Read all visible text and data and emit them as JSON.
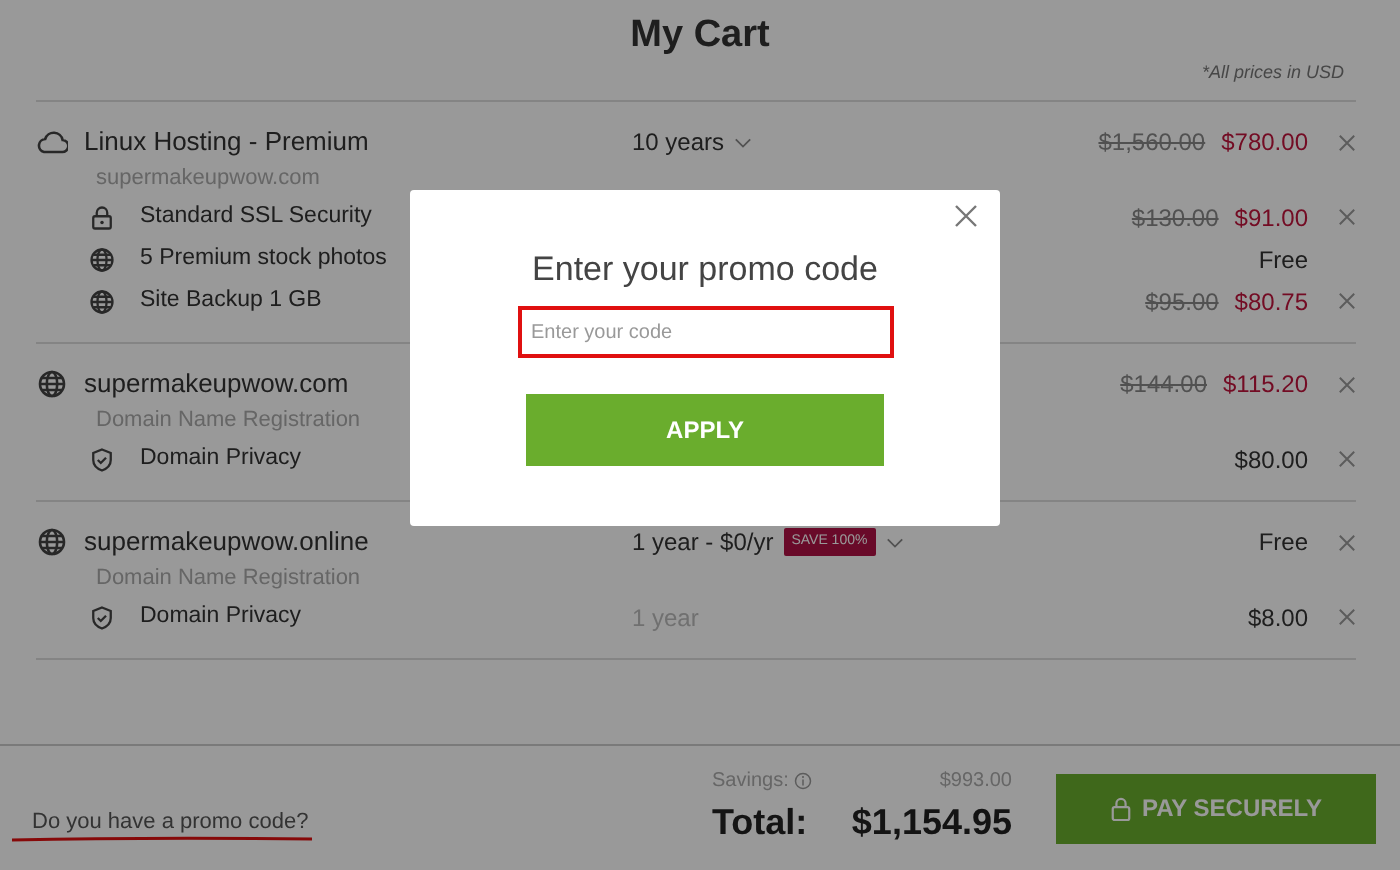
{
  "page": {
    "title": "My Cart",
    "price_note": "*All prices in USD"
  },
  "groups": [
    {
      "kind": "cloud",
      "name": "Linux Hosting - Premium",
      "subtitle": "supermakeupwow.com",
      "term": "10 years",
      "old_price": "$1,560.00",
      "price": "$780.00",
      "discounted": true,
      "removable": true,
      "addons": [
        {
          "kind": "lock",
          "name": "Standard SSL Security",
          "old_price": "$130.00",
          "price": "$91.00",
          "discounted": true,
          "removable": true
        },
        {
          "kind": "globe",
          "name": "5 Premium stock photos",
          "price": "Free",
          "discounted": false,
          "removable": false
        },
        {
          "kind": "globe",
          "name": "Site Backup 1 GB",
          "old_price": "$95.00",
          "price": "$80.75",
          "discounted": true,
          "removable": true
        }
      ]
    },
    {
      "kind": "globe",
      "name": "supermakeupwow.com",
      "subtitle": "Domain Name Registration",
      "old_price": "$144.00",
      "price": "$115.20",
      "discounted": true,
      "removable": true,
      "addons": [
        {
          "kind": "shield",
          "name": "Domain Privacy",
          "price": "$80.00",
          "discounted": false,
          "removable": true
        }
      ]
    },
    {
      "kind": "globe",
      "name": "supermakeupwow.online",
      "subtitle": "Domain Name Registration",
      "term": "1 year - $0/yr",
      "badge": "SAVE 100%",
      "price": "Free",
      "discounted": false,
      "removable": true,
      "addons": [
        {
          "kind": "shield",
          "name": "Domain Privacy",
          "term": "1 year",
          "price": "$8.00",
          "discounted": false,
          "removable": true
        }
      ]
    }
  ],
  "footer": {
    "promo_link": "Do you have a promo code?",
    "savings_label": "Savings:",
    "savings": "$993.00",
    "total_label": "Total:",
    "total": "$1,154.95",
    "pay_button": "PAY SECURELY"
  },
  "modal": {
    "title": "Enter your promo code",
    "placeholder": "Enter your code",
    "button": "APPLY"
  }
}
